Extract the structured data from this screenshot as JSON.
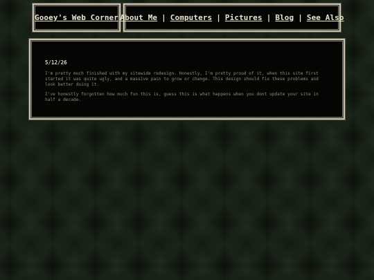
{
  "header": {
    "site_title": "Gooey's Web Corner"
  },
  "nav": {
    "items": [
      {
        "label": "About Me"
      },
      {
        "label": "Computers"
      },
      {
        "label": "Pictures"
      },
      {
        "label": "Blog"
      },
      {
        "label": "See Also"
      }
    ],
    "separator": "|"
  },
  "post": {
    "date": "5/12/26",
    "paragraphs": [
      "I'm pretty much finished with my sitewide redesign. Honestly, I'm pretty proud of it, when this site first started it was quite ugly, and a massive pain to grow or change. This design should fix these problems and look better doing it.",
      "I've honestly forgotten how much fun this is, guess this is what happens when you dont update your site in half a decade."
    ]
  },
  "colors": {
    "panel_background": "#050604",
    "panel_border": "#c8c2ae",
    "link_text": "#e9e4cf",
    "body_text": "#8f8b7a",
    "page_background": "#1d2a1b"
  }
}
